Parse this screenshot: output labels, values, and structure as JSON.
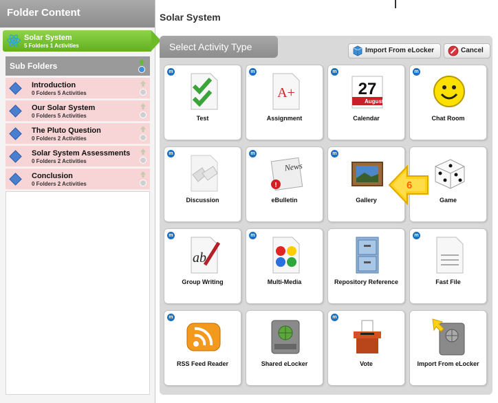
{
  "sidebar": {
    "header": "Folder Content",
    "current_folder": {
      "name": "Solar System",
      "count": "5 Folders 1 Activities"
    },
    "sub_header": "Sub Folders",
    "subfolders": [
      {
        "name": "Introduction",
        "count": "0 Folders 5 Activities"
      },
      {
        "name": "Our Solar System",
        "count": "0 Folders 5 Activities"
      },
      {
        "name": "The Pluto Question",
        "count": "0 Folders 2 Activities"
      },
      {
        "name": "Solar System Assessments",
        "count": "0 Folders 2 Activities"
      },
      {
        "name": "Conclusion",
        "count": "0 Folders 2 Activities"
      }
    ]
  },
  "main": {
    "title": "Solar System",
    "panel_tab": "Select Activity Type",
    "import_label": "Import From eLocker",
    "cancel_label": "Cancel"
  },
  "activities": [
    {
      "label": "Test",
      "icon": "test-icon",
      "badge": "m"
    },
    {
      "label": "Assignment",
      "icon": "assignment-icon",
      "badge": "m",
      "glyph": "A+"
    },
    {
      "label": "Calendar",
      "icon": "calendar-icon",
      "badge": "m",
      "day": "27",
      "month": "August"
    },
    {
      "label": "Chat Room",
      "icon": "chat-room-icon",
      "badge": "m"
    },
    {
      "label": "Discussion",
      "icon": "discussion-icon",
      "badge": "m"
    },
    {
      "label": "eBulletin",
      "icon": "ebulletin-icon",
      "badge": "m",
      "glyph": "News"
    },
    {
      "label": "Gallery",
      "icon": "gallery-icon",
      "badge": "m"
    },
    {
      "label": "Game",
      "icon": "game-icon",
      "badge": ""
    },
    {
      "label": "Group Writing",
      "icon": "group-writing-icon",
      "badge": "m",
      "glyph": "ab"
    },
    {
      "label": "Multi-Media",
      "icon": "multi-media-icon",
      "badge": "m"
    },
    {
      "label": "Repository Reference",
      "icon": "repository-reference-icon",
      "badge": ""
    },
    {
      "label": "Fast File",
      "icon": "fast-file-icon",
      "badge": "m"
    },
    {
      "label": "RSS Feed Reader",
      "icon": "rss-feed-icon",
      "badge": "m"
    },
    {
      "label": "Shared eLocker",
      "icon": "shared-elocker-icon",
      "badge": ""
    },
    {
      "label": "Vote",
      "icon": "vote-icon",
      "badge": "m"
    },
    {
      "label": "Import From eLocker",
      "icon": "import-elocker-icon",
      "badge": ""
    }
  ],
  "callout": {
    "number": "6"
  },
  "colors": {
    "accent_green": "#62b020",
    "subfolder_bg": "#f7d4d6",
    "badge_blue": "#1d6fc2",
    "callout": "#ffd21a"
  }
}
